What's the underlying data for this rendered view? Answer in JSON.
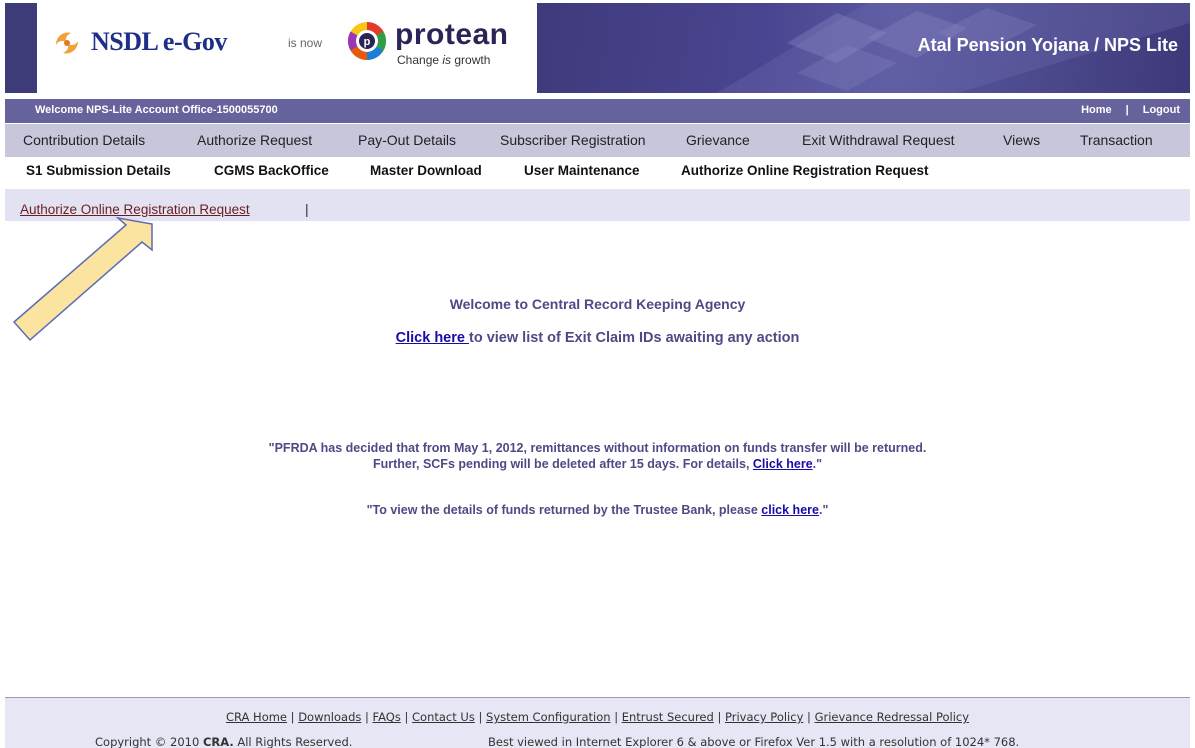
{
  "header": {
    "nsdl_text": "NSDL e-Gov",
    "is_now": "is now",
    "protean_text": "protean",
    "tagline_pre": "Change ",
    "tagline_is": "is",
    "tagline_post": " growth",
    "banner_title": "Atal Pension Yojana / NPS Lite"
  },
  "welcome_bar": {
    "welcome_text": "Welcome NPS-Lite Account Office-1500055700",
    "home": "Home",
    "separator": "|",
    "logout": "Logout"
  },
  "menu_primary": [
    "Contribution Details",
    "Authorize Request",
    "Pay-Out Details",
    "Subscriber Registration",
    "Grievance",
    "Exit Withdrawal Request",
    "Views",
    "Transaction"
  ],
  "menu_secondary": [
    "S1 Submission Details",
    "CGMS BackOffice",
    "Master Download",
    "User Maintenance",
    "Authorize Online Registration Request"
  ],
  "subnav": {
    "link": "Authorize Online Registration Request",
    "pipe": "|"
  },
  "main": {
    "welcome": "Welcome to Central Record Keeping Agency",
    "exit_link": "Click here ",
    "exit_text": "to view list of Exit Claim IDs awaiting any action",
    "notice1_line1": "\"PFRDA has decided that from May 1, 2012, remittances without information on funds transfer will be returned.",
    "notice1_line2_pre": "Further, SCFs pending will be deleted after 15 days. For details, ",
    "notice1_link": "Click here",
    "notice1_post": ".\"",
    "notice2_pre": "\"To view the details of funds returned by the Trustee Bank, please ",
    "notice2_link": "click here",
    "notice2_post": ".\""
  },
  "footer": {
    "links": [
      "CRA Home",
      "Downloads",
      "FAQs",
      "Contact Us",
      "System Configuration",
      "Entrust Secured",
      "Privacy Policy",
      "Grievance Redressal Policy"
    ],
    "link_separator": " | ",
    "copyright_pre": "Copyright © 2010 ",
    "copyright_bold": "CRA.",
    "copyright_post": " All Rights Reserved.",
    "best_viewed": "Best viewed in Internet Explorer 6 & above or Firefox Ver 1.5 with a resolution of 1024* 768."
  },
  "colors": {
    "banner": "#4a4590",
    "welcome_bar": "#66629b",
    "menu_bg": "#c8c6da",
    "subnav_bg": "#e3e2f3",
    "heading_text": "#4d4a85",
    "link": "#1a0aa8",
    "arrow_fill": "#fbe3a0"
  }
}
